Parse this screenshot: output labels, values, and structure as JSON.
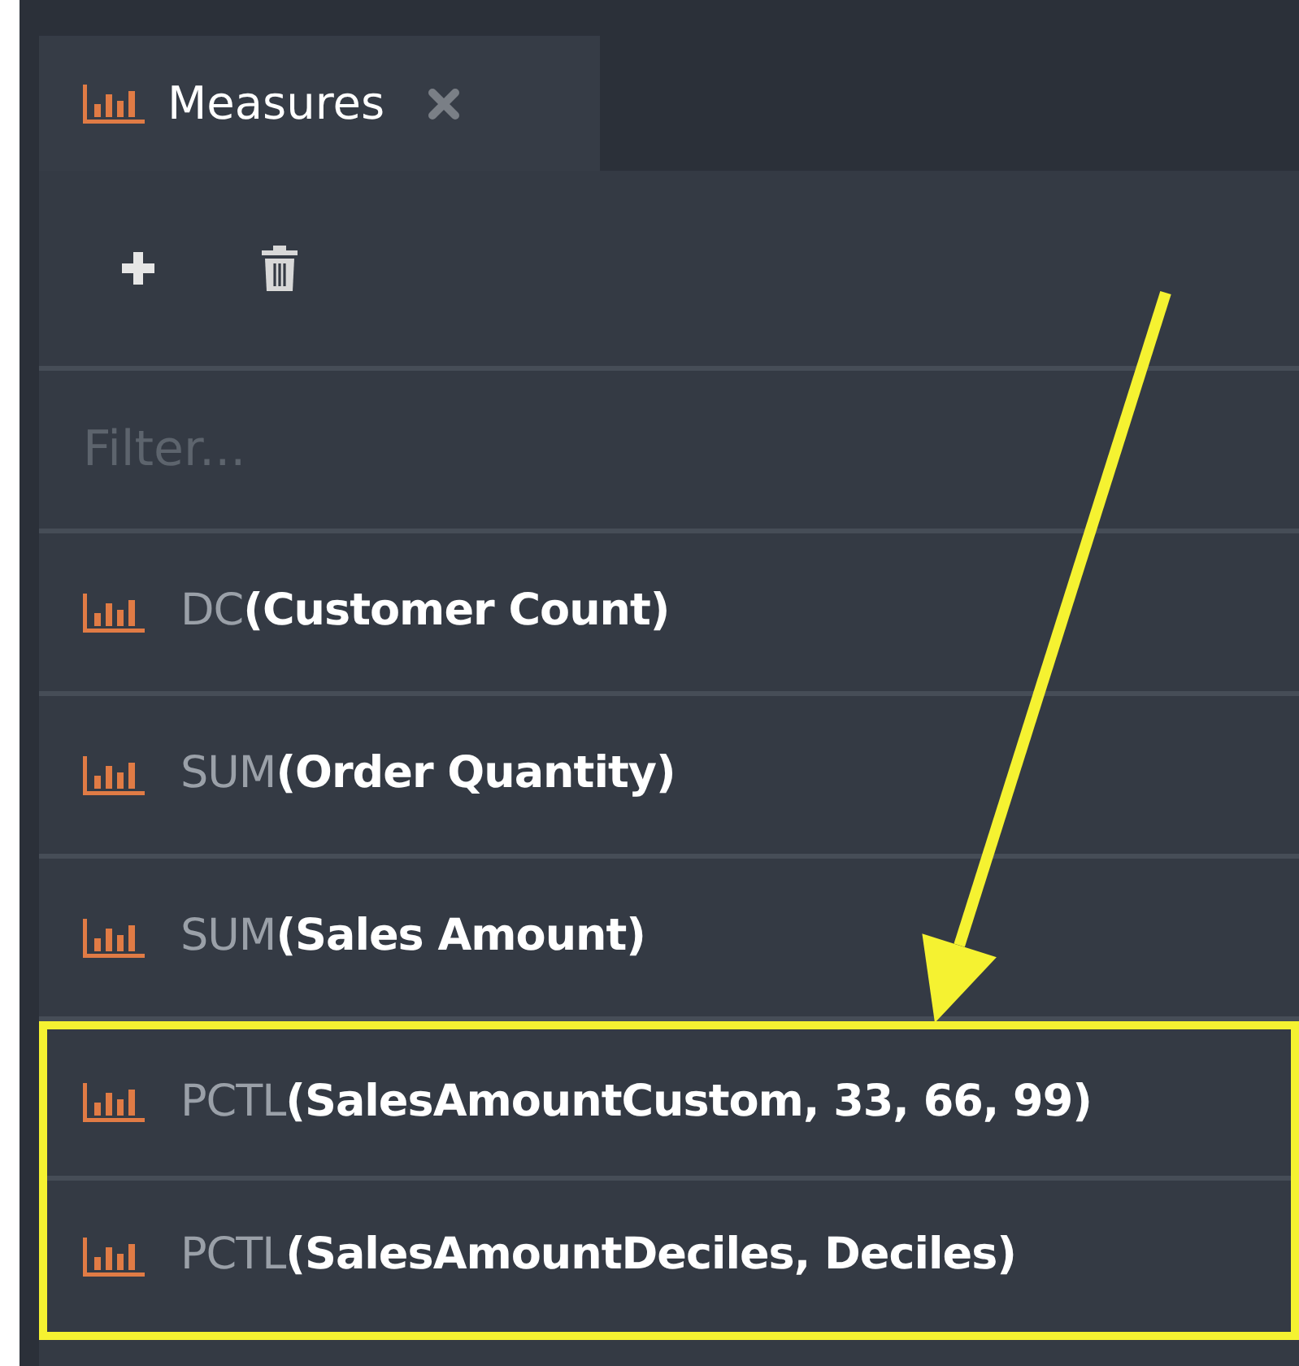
{
  "tab": {
    "label": "Measures",
    "selected": true
  },
  "toolbar": {
    "buttons": [
      {
        "kind": "add"
      },
      {
        "kind": "delete"
      }
    ]
  },
  "filter": {
    "placeholder": "Filter..."
  },
  "measures": [
    {
      "function": "DC",
      "argument": "(Customer Count)",
      "highlighted": false
    },
    {
      "function": "SUM",
      "argument": "(Order Quantity)",
      "highlighted": false
    },
    {
      "function": "SUM",
      "argument": "(Sales Amount)",
      "highlighted": false
    },
    {
      "function": "PCTL",
      "argument": "(SalesAmountCustom, 33, 66, 99)",
      "highlighted": true
    },
    {
      "function": "PCTL",
      "argument": "(SalesAmountDeciles, Deciles)",
      "highlighted": true
    }
  ]
}
